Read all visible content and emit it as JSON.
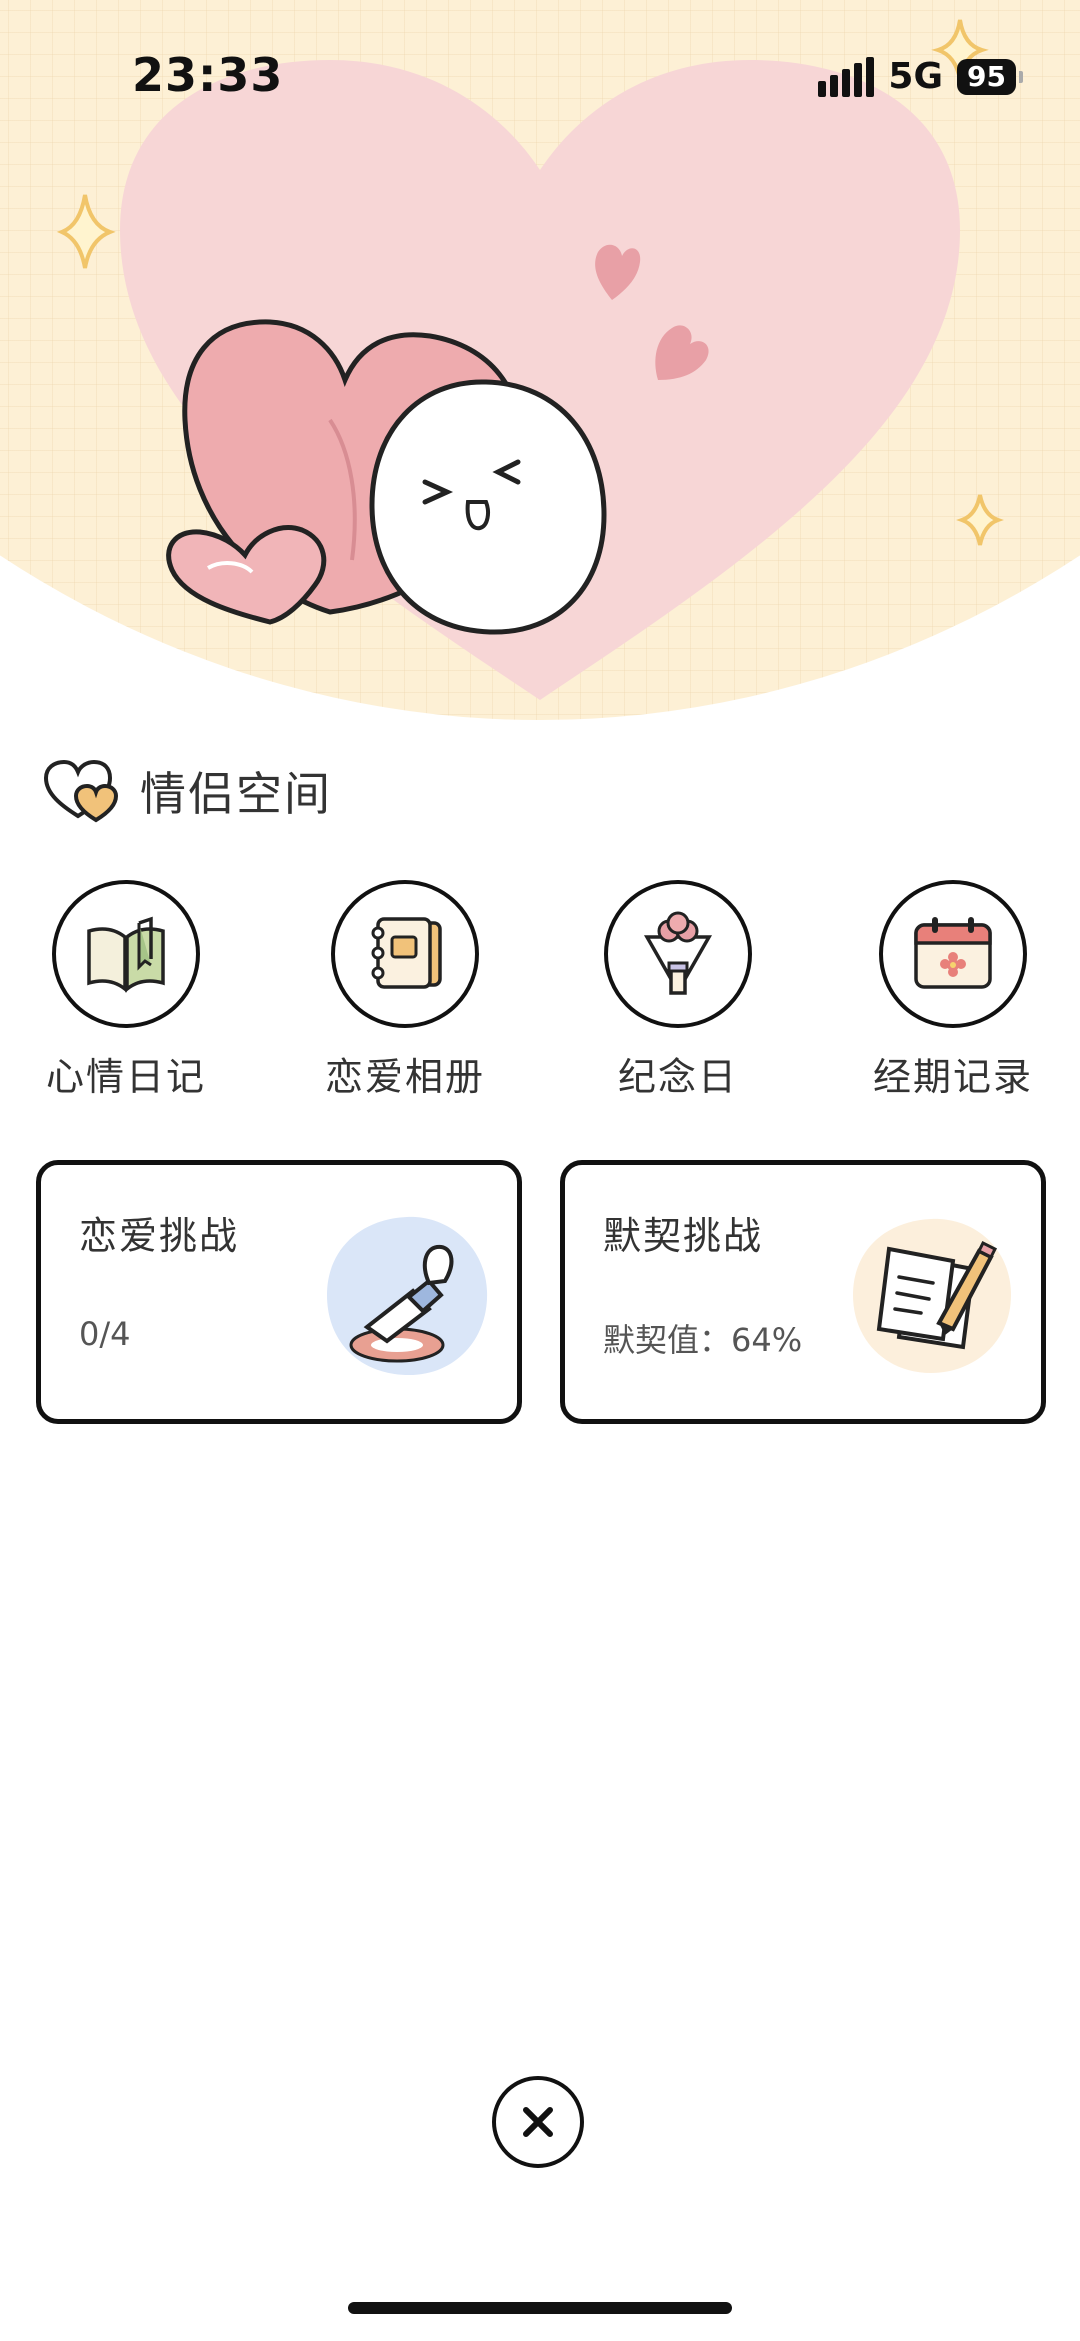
{
  "status_bar": {
    "time": "23:33",
    "network": "5G",
    "battery": "95"
  },
  "section": {
    "title": "情侣空间"
  },
  "features": [
    {
      "label": "心情日记",
      "icon": "diary-book-icon"
    },
    {
      "label": "恋爱相册",
      "icon": "photo-album-icon"
    },
    {
      "label": "纪念日",
      "icon": "bouquet-icon"
    },
    {
      "label": "经期记录",
      "icon": "calendar-icon"
    }
  ],
  "cards": [
    {
      "title": "恋爱挑战",
      "value": "0/4",
      "icon": "stamp-icon"
    },
    {
      "title": "默契挑战",
      "value": "默契值：64%",
      "icon": "note-pencil-icon"
    }
  ],
  "colors": {
    "hero_bg": "#fdf0d5",
    "heart_pink": "#f7d6d6",
    "accent_pink": "#eeabae",
    "sparkle": "#f1c56a"
  }
}
